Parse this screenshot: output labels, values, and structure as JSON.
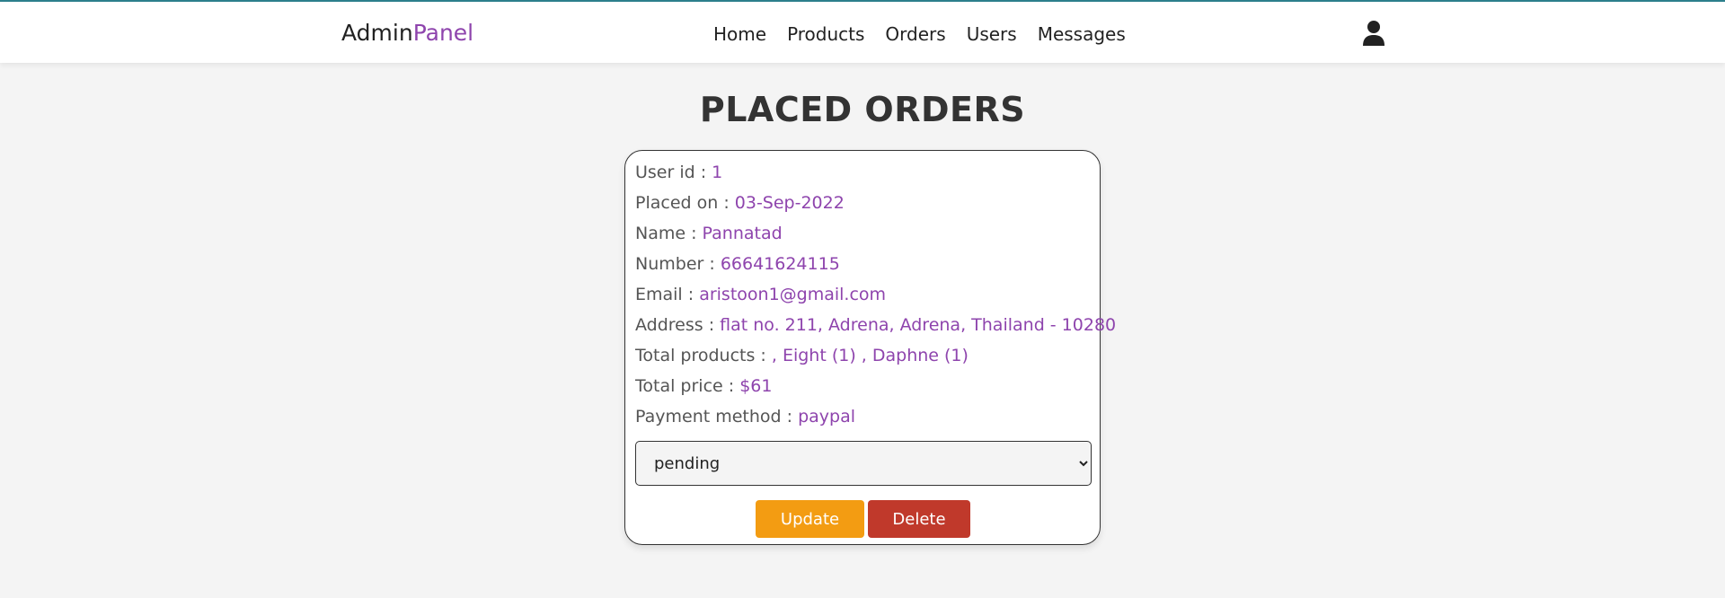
{
  "header": {
    "logo_main": "Admin",
    "logo_accent": "Panel",
    "nav": [
      {
        "label": "Home"
      },
      {
        "label": "Products"
      },
      {
        "label": "Orders"
      },
      {
        "label": "Users"
      },
      {
        "label": "Messages"
      }
    ],
    "user_icon": "user-icon"
  },
  "page": {
    "title": "PLACED ORDERS"
  },
  "order": {
    "fields": [
      {
        "label": "User id : ",
        "value": "1"
      },
      {
        "label": "Placed on : ",
        "value": "03-Sep-2022"
      },
      {
        "label": "Name : ",
        "value": "Pannatad"
      },
      {
        "label": "Number : ",
        "value": "66641624115"
      },
      {
        "label": "Email : ",
        "value": "aristoon1@gmail.com"
      },
      {
        "label": "Address : ",
        "value": "flat no. 211, Adrena, Adrena, Thailand - 10280"
      },
      {
        "label": "Total products : ",
        "value": ", Eight (1) , Daphne (1)"
      },
      {
        "label": "Total price : ",
        "value": "$61"
      },
      {
        "label": "Payment method : ",
        "value": "paypal"
      }
    ],
    "status_selected": "pending",
    "update_label": "Update",
    "delete_label": "Delete"
  },
  "colors": {
    "accent": "#8e44ad",
    "update": "#f39c12",
    "delete": "#c0392b",
    "background": "#f4f4f4"
  }
}
